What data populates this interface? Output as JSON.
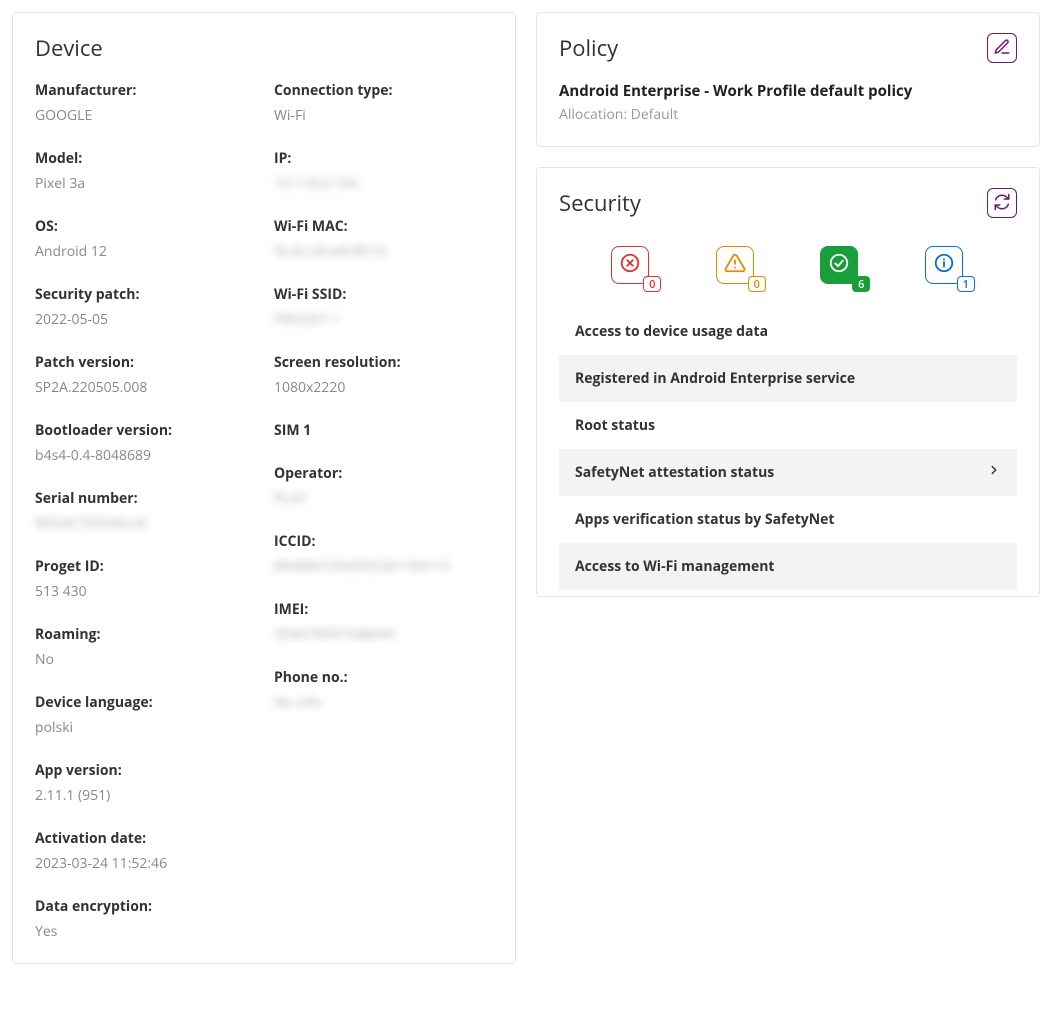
{
  "device": {
    "title": "Device",
    "left": [
      {
        "label": "Manufacturer:",
        "value": "GOOGLE"
      },
      {
        "label": "Model:",
        "value": "Pixel 3a"
      },
      {
        "label": "OS:",
        "value": "Android 12"
      },
      {
        "label": "Security patch:",
        "value": "2022-05-05"
      },
      {
        "label": "Patch version:",
        "value": "SP2A.220505.008"
      },
      {
        "label": "Bootloader version:",
        "value": "b4s4-0.4-8048689"
      },
      {
        "label": "Serial number:",
        "value": "REDACTEDVALUE",
        "blur": true
      },
      {
        "label": "Proget ID:",
        "value": "513 430"
      },
      {
        "label": "Roaming:",
        "value": "No"
      },
      {
        "label": "Device language:",
        "value": "polski"
      },
      {
        "label": "App version:",
        "value": "2.11.1 (951)"
      },
      {
        "label": "Activation date:",
        "value": "2023-03-24 11:52:46"
      },
      {
        "label": "Data encryption:",
        "value": "Yes"
      }
    ],
    "right": [
      {
        "label": "Connection type:",
        "value": "Wi-Fi"
      },
      {
        "label": "IP:",
        "value": "10.118.0.134",
        "blur": true
      },
      {
        "label": "Wi-Fi MAC:",
        "value": "9c:0c:d0:e8:98:10",
        "blur": true
      },
      {
        "label": "Wi-Fi SSID:",
        "value": "PROGET-1",
        "blur": true
      },
      {
        "label": "Screen resolution:",
        "value": "1080x2220"
      },
      {
        "heading": "SIM 1"
      },
      {
        "label": "Operator:",
        "value": "PLAY",
        "blur": true
      },
      {
        "label": "ICCID:",
        "value": "8948061050055281169115",
        "blur": true
      },
      {
        "label": "IMEI:",
        "value": "359679097548044",
        "blur": true
      },
      {
        "label": "Phone no.:",
        "value": "No info",
        "blur": true
      }
    ]
  },
  "policy": {
    "title": "Policy",
    "name": "Android Enterprise - Work Profile default policy",
    "allocation_label": "Allocation: Default"
  },
  "security": {
    "title": "Security",
    "counts": {
      "error": "0",
      "warning": "0",
      "ok": "6",
      "info": "1"
    },
    "items": [
      {
        "label": "Access to device usage data",
        "alt": false,
        "chevron": false
      },
      {
        "label": "Registered in Android Enterprise service",
        "alt": true,
        "chevron": false
      },
      {
        "label": "Root status",
        "alt": false,
        "chevron": false
      },
      {
        "label": "SafetyNet attestation status",
        "alt": true,
        "chevron": true
      },
      {
        "label": "Apps verification status by SafetyNet",
        "alt": false,
        "chevron": false
      },
      {
        "label": "Access to Wi-Fi management",
        "alt": true,
        "chevron": false
      }
    ]
  }
}
